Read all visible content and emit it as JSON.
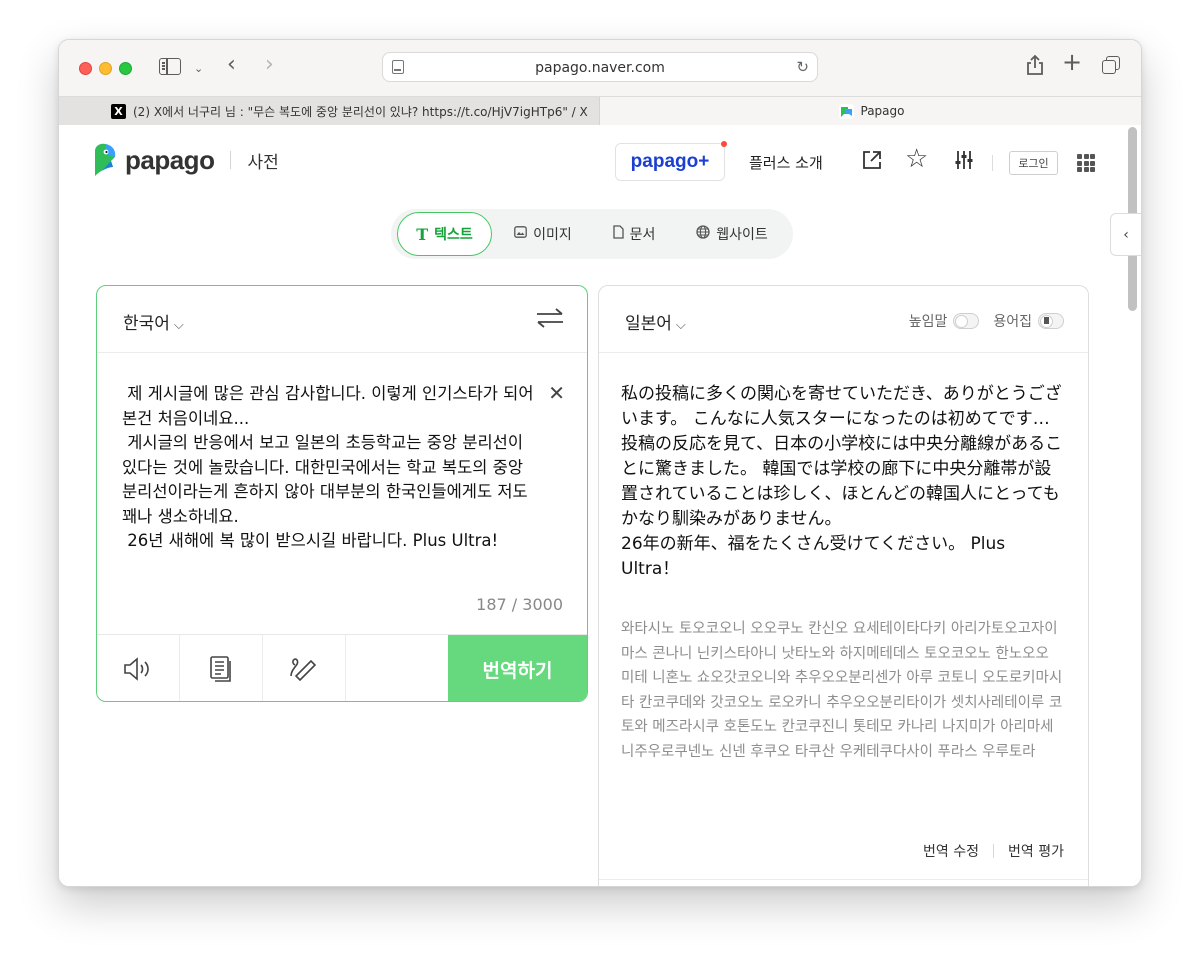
{
  "browser": {
    "url": "papago.naver.com",
    "tabs": [
      {
        "icon": "X",
        "title": "(2) X에서 너구리 님 : \"무슨 복도에 중앙 분리선이 있냐? https://t.co/HjV7igHTp6\" / X"
      },
      {
        "title": "Papago"
      }
    ]
  },
  "header": {
    "brand": "papago",
    "dictionary": "사전",
    "plus_label": "papago+",
    "plus_intro": "플러스 소개",
    "login": "로그인"
  },
  "modes": {
    "text": "텍스트",
    "image": "이미지",
    "document": "문서",
    "website": "웹사이트"
  },
  "source": {
    "language": "한국어",
    "text": " 제 게시글에 많은 관심 감사합니다. 이렇게 인기스타가 되어본건 처음이네요...\n 게시글의 반응에서 보고 일본의 초등학교는 중앙 분리선이 있다는 것에 놀랐습니다. 대한민국에서는 학교 복도의 중앙 분리선이라는게 흔하지 않아 대부분의 한국인들에게도 저도 꽤나 생소하네요.\n 26년 새해에 복 많이 받으시길 바랍니다. Plus Ultra!",
    "char_count": "187 / 3000",
    "translate_button": "번역하기"
  },
  "target": {
    "language": "일본어",
    "honorific_label": "높임말",
    "glossary_label": "용어집",
    "text": "私の投稿に多くの関心を寄せていただき、ありがとうございます。 こんなに人気スターになったのは初めてです…\n投稿の反応を見て、日本の小学校には中央分離線があることに驚きました。 韓国では学校の廊下に中央分離帯が設置されていることは珍しく、ほとんどの韓国人にとってもかなり馴染みがありません。\n26年の新年、福をたくさん受けてください。 Plus Ultra！",
    "pronunciation": "와타시노 토오코오니 오오쿠노 칸신오 요세테이타다키 아리가토오고자이마스 콘나니 닌키스타아니 낫타노와 하지메테데스 토오코오노 한노오오 미테 니혼노 쇼오갓코오니와 추우오오분리센가 아루 코토니 오도로키마시타 칸코쿠데와 갓코오노 로오카니 추우오오분리타이가 셋치사레테이루 코토와 메즈라시쿠 호톤도노 칸코쿠진니 톳테모 카나리 나지미가 아리마세 니주우로쿠넨노 신넨 후쿠오 타쿠산 우케테쿠다사이 푸라스 우루토라",
    "edit_label": "번역 수정",
    "rate_label": "번역 평가"
  },
  "colors": {
    "accent_green": "#66d87d",
    "brand_blue": "#1a3fd1"
  }
}
